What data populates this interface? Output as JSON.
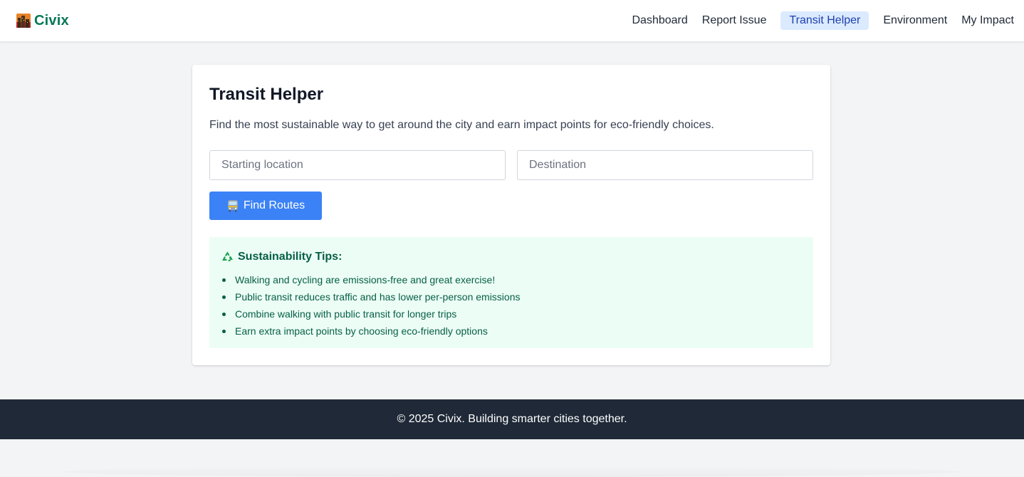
{
  "header": {
    "brand_name": "Civix",
    "brand_icon": "city-icon",
    "nav": [
      {
        "label": "Dashboard",
        "active": false
      },
      {
        "label": "Report Issue",
        "active": false
      },
      {
        "label": "Transit Helper",
        "active": true
      },
      {
        "label": "Environment",
        "active": false
      },
      {
        "label": "My Impact",
        "active": false
      }
    ]
  },
  "main": {
    "title": "Transit Helper",
    "description": "Find the most sustainable way to get around the city and earn impact points for eco-friendly choices.",
    "start_field": {
      "placeholder": "Starting location",
      "value": ""
    },
    "destination_field": {
      "placeholder": "Destination",
      "value": ""
    },
    "find_button": {
      "icon": "bus-icon",
      "label": "Find Routes"
    },
    "tips": {
      "icon": "recycle-icon",
      "title": "Sustainability Tips:",
      "items": [
        "Walking and cycling are emissions-free and great exercise!",
        "Public transit reduces traffic and has lower per-person emissions",
        "Combine walking with public transit for longer trips",
        "Earn extra impact points by choosing eco-friendly options"
      ]
    }
  },
  "footer": {
    "text": "© 2025 Civix. Building smarter cities together."
  },
  "colors": {
    "brand": "#047857",
    "accent": "#3b82f6",
    "active_nav_bg": "#dbeafe",
    "active_nav_text": "#1e40af",
    "tips_bg": "#ecfdf5",
    "tips_text": "#065f46",
    "footer_bg": "#1f2937"
  }
}
